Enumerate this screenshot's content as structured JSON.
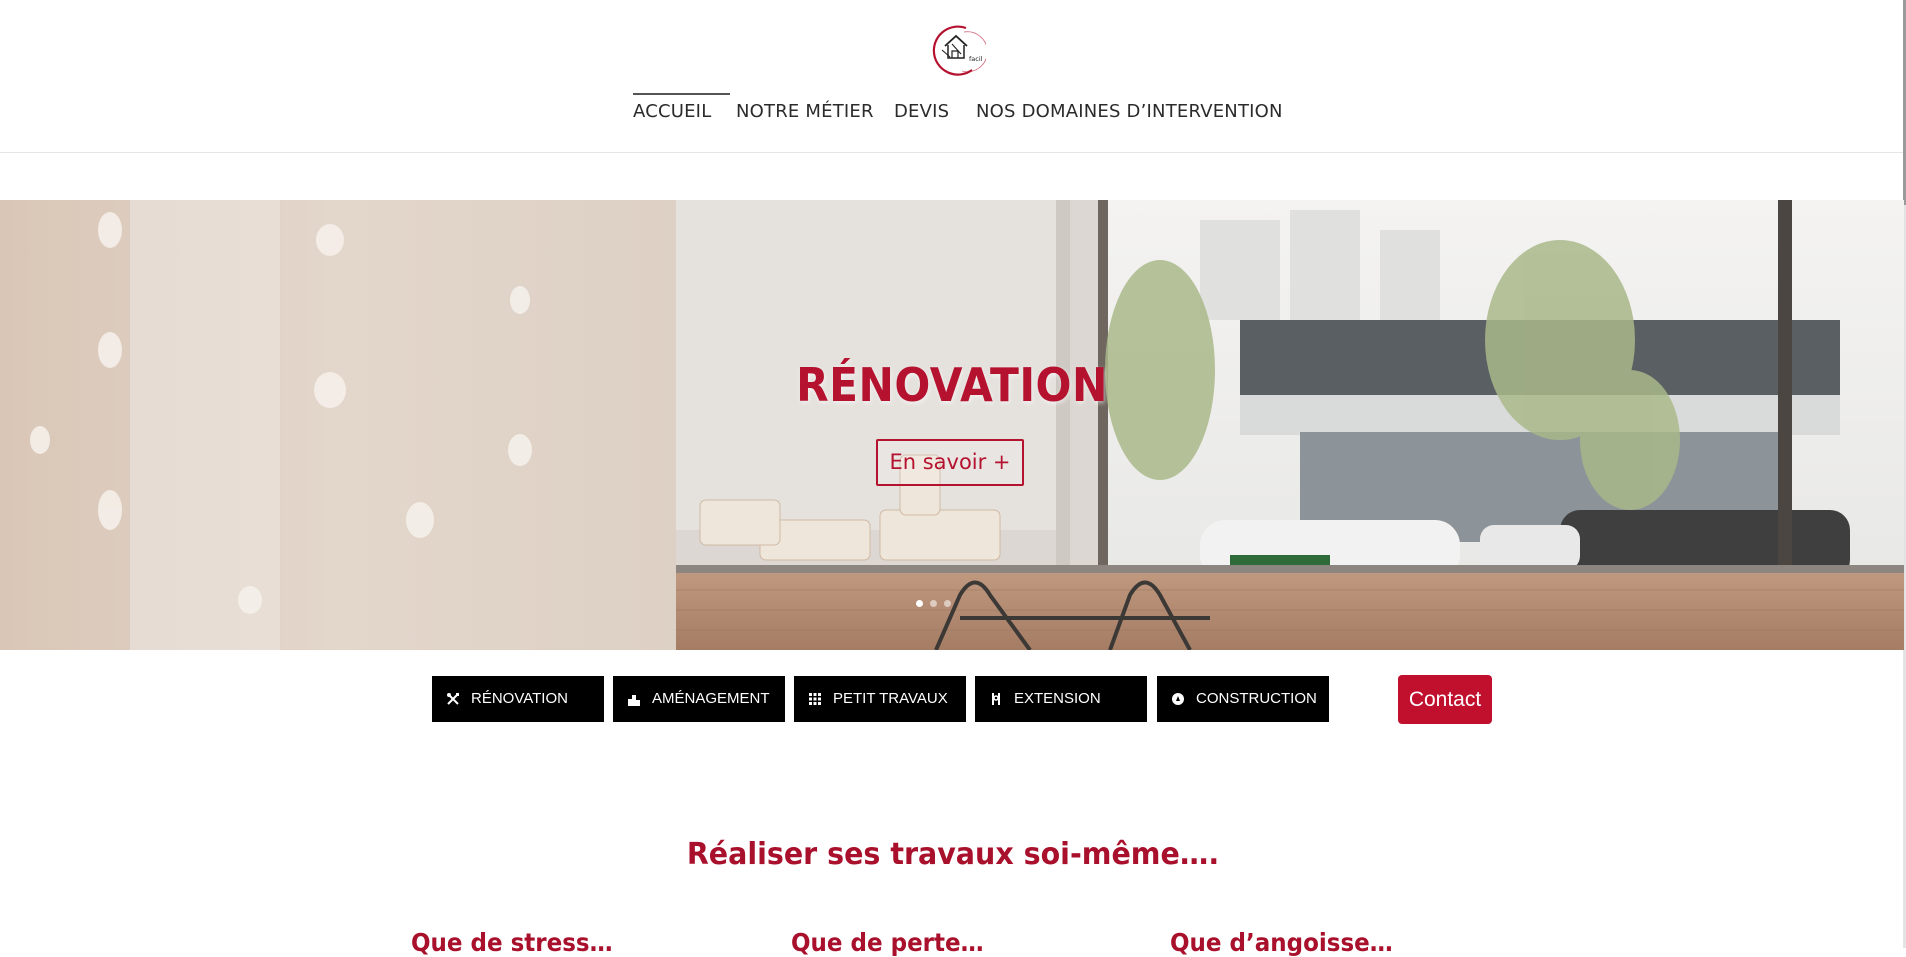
{
  "header": {
    "logo_text": "facil",
    "nav": [
      {
        "label": "ACCUEIL",
        "active": true
      },
      {
        "label": "NOTRE MÉTIER",
        "active": false
      },
      {
        "label": "DEVIS",
        "active": false
      },
      {
        "label": "NOS DOMAINES D’INTERVENTION",
        "active": false
      }
    ]
  },
  "hero": {
    "title": "RÉNOVATION",
    "cta_label": "En savoir +",
    "slide_count": 3,
    "active_slide": 1
  },
  "categories": [
    {
      "label": "RÉNOVATION",
      "icon": "tools-icon"
    },
    {
      "label": "AMÉNAGEMENT",
      "icon": "building-icon"
    },
    {
      "label": "PETIT TRAVAUX",
      "icon": "grid-icon"
    },
    {
      "label": "EXTENSION",
      "icon": "pliers-icon"
    },
    {
      "label": "CONSTRUCTION",
      "icon": "compass-icon"
    }
  ],
  "contact_label": "Contact",
  "intro": {
    "heading": "Réaliser ses travaux soi-même….",
    "features": [
      "Que de stress…",
      "Que de perte…",
      "Que d’angoisse…"
    ]
  },
  "colors": {
    "brand_red": "#c0102e",
    "heading_red": "#a8102b",
    "category_bg": "#000000"
  }
}
